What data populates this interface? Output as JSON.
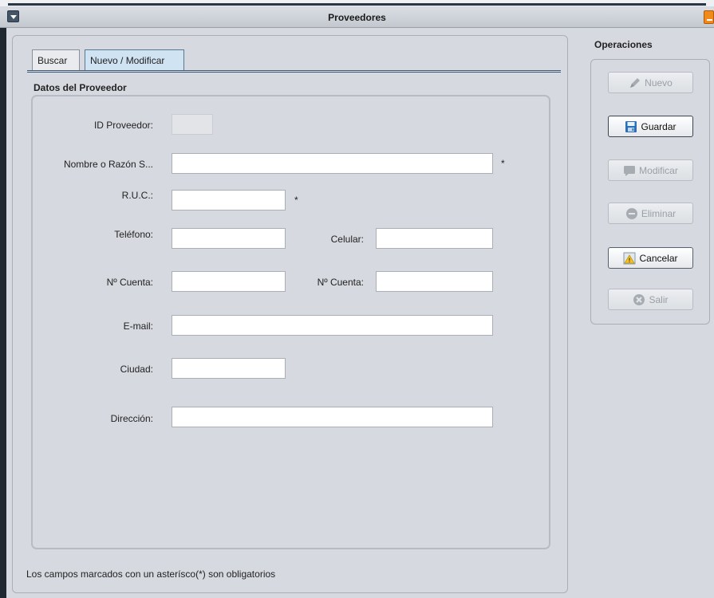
{
  "window": {
    "title": "Proveedores"
  },
  "tabs": [
    {
      "label": "Buscar",
      "active": false
    },
    {
      "label": "Nuevo / Modificar",
      "active": true
    }
  ],
  "form": {
    "section_title": "Datos del Proveedor",
    "id_label": "ID Proveedor:",
    "id_value": "",
    "nombre_label": "Nombre o Razón S...",
    "nombre_value": "",
    "ruc_label": "R.U.C.:",
    "ruc_value": "",
    "telefono_label": "Teléfono:",
    "telefono_value": "",
    "celular_label": "Celular:",
    "celular_value": "",
    "cuenta1_label": "Nº Cuenta:",
    "cuenta1_value": "",
    "cuenta2_label": "Nº Cuenta:",
    "cuenta2_value": "",
    "email_label": "E-mail:",
    "email_value": "",
    "ciudad_label": "Ciudad:",
    "ciudad_value": "",
    "direccion_label": "Dirección:",
    "direccion_value": "",
    "required_mark": "*",
    "footer_note": "Los campos marcados con un asterísco(*) son obligatorios"
  },
  "operations": {
    "title": "Operaciones",
    "buttons": [
      {
        "label": "Nuevo",
        "icon": "pencil-icon",
        "enabled": false
      },
      {
        "label": "Guardar",
        "icon": "save-icon",
        "enabled": true
      },
      {
        "label": "Modificar",
        "icon": "comment-icon",
        "enabled": false
      },
      {
        "label": "Eliminar",
        "icon": "minus-circle-icon",
        "enabled": false
      },
      {
        "label": "Cancelar",
        "icon": "warning-icon",
        "enabled": true
      },
      {
        "label": "Salir",
        "icon": "close-circle-icon",
        "enabled": false
      }
    ]
  },
  "colors": {
    "background": "#d6d9df",
    "active_tab": "#cfe3f3",
    "minimize_button": "#f08a1a"
  }
}
